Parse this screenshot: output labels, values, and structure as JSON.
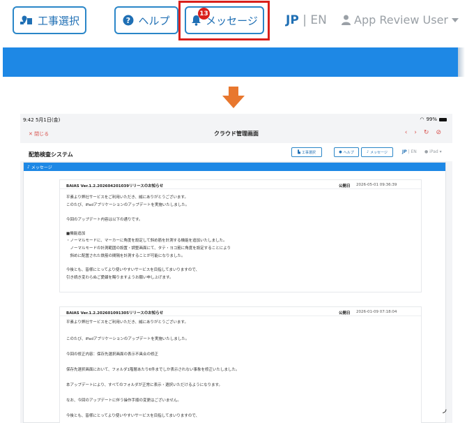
{
  "zoom": {
    "koji_label": "工事選択",
    "help_label": "ヘルプ",
    "message_label": "メッセージ",
    "badge_count": "13",
    "lang_jp": "JP",
    "lang_sep": "|",
    "lang_en": "EN",
    "user_label": "App Review User"
  },
  "tablet": {
    "status_time": "9:42  5月1日(金)",
    "status_battery": "99%",
    "close_label": "✕ 閉じる",
    "nav_title": "クラウド管理画面",
    "app_title": "配筋検査システム",
    "koji_label": "工事選択",
    "help_label": "ヘルプ",
    "message_label": "メッセージ",
    "lang_jp": "JP",
    "lang_sep": "|",
    "lang_en": "EN",
    "user_label": "iPad",
    "panel_title": "メッセージ",
    "messages": [
      {
        "title": "BAIAS Ver.1.2.202604201039リリースのお知らせ",
        "date_label": "公開日",
        "date": "2026-05-01 09:36:39",
        "lines": [
          "平素より弊社サービスをご利用いただき、誠にありがとうございます。",
          "このたび、iPadアプリケーションのアップデートを実施いたしました。",
          "今回のアップデート内容は以下の通りです。",
          "■機能追加",
          "・ノーマルモードに、マーカーに角度を設定して斜め筋を計測する機能を追加いたしました。",
          "　ノーマルモードの計測範囲の設置・調整画面にて、タテ・ヨコ筋に角度を設定することにより",
          "　斜めに配置された鉄筋の間隔を計測することが可能になりました。",
          "今後とも、皆様にとってより使いやすいサービスを目指してまいりますので、",
          "引き続き変わらぬご愛顧を賜りますようお願い申し上げます。"
        ]
      },
      {
        "title": "BAIAS Ver.1.2.202601091305リリースのお知らせ",
        "date_label": "公開日",
        "date": "2026-01-09 07:18:04",
        "lines": [
          "平素より弊社サービスをご利用いただき、誠にありがとうございます。",
          "このたび、iPadアプリケーションのアップデートを実施いたしました。",
          "今回の修正内容：保存先選択画面の表示不具合の修正",
          "保存先選択画面において、フォルダ1階層あたり6件までしか表示されない事象を修正いたしました。",
          "本アップデートにより、すべてのフォルダが正常に表示・選択いただけるようになります。",
          "なお、今回のアップデートに伴う操作手順の変更はございません。",
          "今後とも、皆様にとってより使いやすいサービスを目指してまいりますので、"
        ]
      }
    ]
  },
  "colors": {
    "accent": "#1e88e5",
    "highlight": "#d9201b",
    "arrow": "#e8772e"
  }
}
